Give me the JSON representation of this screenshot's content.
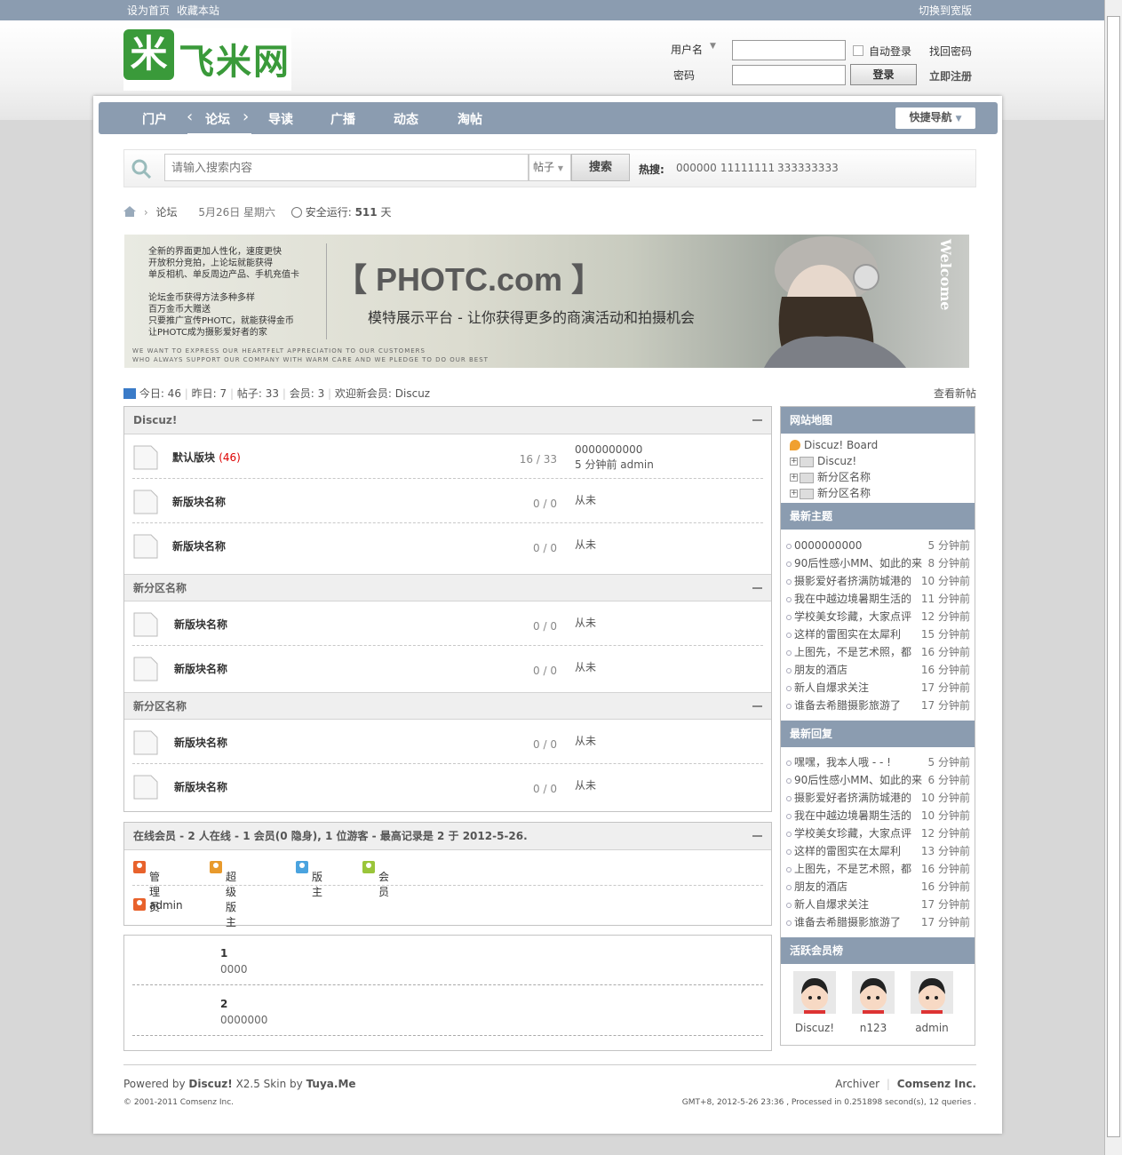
{
  "topbar": {
    "set_home": "设为首页",
    "bookmark": "收藏本站",
    "switch_wide": "切换到宽版"
  },
  "logo": {
    "char": "米",
    "name": "飞米网"
  },
  "login": {
    "username_label": "用户名",
    "password_label": "密码",
    "auto_login": "自动登录",
    "find_password": "找回密码",
    "login_button": "登录",
    "register": "立即注册"
  },
  "nav": {
    "items": [
      "门户",
      "论坛",
      "导读",
      "广播",
      "动态",
      "淘帖"
    ],
    "quick_nav": "快捷导航"
  },
  "search": {
    "placeholder": "请输入搜索内容",
    "type": "帖子",
    "button": "搜索",
    "hot_label": "热搜:",
    "hot_words": [
      "000000",
      "11111111",
      "333333333"
    ]
  },
  "breadcrumb": {
    "forum": "论坛",
    "date": "5月26日 星期六",
    "uptime_label": "安全运行:",
    "uptime_value": "511",
    "uptime_unit": "天"
  },
  "banner": {
    "lines": [
      "全新的界面更加人性化，速度更快",
      "开放积分竞拍，上论坛就能获得",
      "单反相机、单反周边产品、手机充值卡",
      "",
      "论坛金币获得方法多种多样",
      "百万金币大赠送",
      "只要推广宣传PHOTC，就能获得金币",
      "让PHOTC成为摄影爱好者的家"
    ],
    "title": "【 PHOTC.com 】",
    "subtitle": "模特展示平台 - 让你获得更多的商演活动和拍摄机会",
    "eng1": "WE WANT TO EXPRESS OUR HEARTFELT APPRECIATION TO OUR CUSTOMERS",
    "eng2": "WHO ALWAYS SUPPORT OUR COMPANY WITH WARM CARE AND WE PLEDGE TO DO OUR BEST",
    "welcome": "Welcome"
  },
  "stats": {
    "today": "今日: 46",
    "yesterday": "昨日: 7",
    "posts": "帖子: 33",
    "members": "会员: 3",
    "welcome": "欢迎新会员: Discuz",
    "view_new": "查看新帖"
  },
  "categories": [
    {
      "name": "Discuz!",
      "forums": [
        {
          "name": "默认版块",
          "today": "(46)",
          "count": "16 / 33",
          "last1": "0000000000",
          "last2": "5 分钟前  admin"
        },
        {
          "name": "新版块名称",
          "today": "",
          "count": "0 / 0",
          "last1": "从未",
          "last2": ""
        },
        {
          "name": "新版块名称",
          "today": "",
          "count": "0 / 0",
          "last1": "从未",
          "last2": ""
        }
      ]
    },
    {
      "name": "新分区名称",
      "forums": [
        {
          "name": "新版块名称",
          "today": "",
          "count": "0 / 0",
          "last1": "从未",
          "last2": ""
        },
        {
          "name": "新版块名称",
          "today": "",
          "count": "0 / 0",
          "last1": "从未",
          "last2": ""
        }
      ]
    },
    {
      "name": "新分区名称",
      "forums": [
        {
          "name": "新版块名称",
          "today": "",
          "count": "0 / 0",
          "last1": "从未",
          "last2": ""
        },
        {
          "name": "新版块名称",
          "today": "",
          "count": "0 / 0",
          "last1": "从未",
          "last2": ""
        }
      ]
    }
  ],
  "online": {
    "title": "在线会员 - 2 人在线 - 1 会员(0 隐身), 1 位游客 - 最高记录是 2 于 2012-5-26.",
    "legend": [
      "管理员",
      "超级版主",
      "版主",
      "会员"
    ],
    "users": [
      "admin"
    ],
    "colors": [
      "#e8622c",
      "#e89a2c",
      "#4aa3df",
      "#9ac53a"
    ]
  },
  "notices": [
    {
      "num": "1",
      "text": "0000"
    },
    {
      "num": "2",
      "text": "0000000"
    }
  ],
  "sidebar": {
    "sitemap_title": "网站地图",
    "tree": [
      "Discuz! Board",
      "Discuz!",
      "新分区名称",
      "新分区名称"
    ],
    "latest_title": "最新主题",
    "latest": [
      [
        "0000000000",
        "5 分钟前"
      ],
      [
        "90后性感小MM、如此的来",
        "8 分钟前"
      ],
      [
        "摄影爱好者挤满防城港的",
        "10 分钟前"
      ],
      [
        "我在中越边境暑期生活的",
        "11 分钟前"
      ],
      [
        "学校美女珍藏，大家点评",
        "12 分钟前"
      ],
      [
        "这样的雷图实在太犀利",
        "15 分钟前"
      ],
      [
        "上图先，不是艺术照，都",
        "16 分钟前"
      ],
      [
        "朋友的酒店",
        "16 分钟前"
      ],
      [
        "新人自爆求关注",
        "17 分钟前"
      ],
      [
        "谁备去希腊摄影旅游了",
        "17 分钟前"
      ]
    ],
    "reply_title": "最新回复",
    "replies": [
      [
        "嘿嘿，我本人哦 - - !",
        "5 分钟前"
      ],
      [
        "90后性感小MM、如此的来",
        "6 分钟前"
      ],
      [
        "摄影爱好者挤满防城港的",
        "10 分钟前"
      ],
      [
        "我在中越边境暑期生活的",
        "10 分钟前"
      ],
      [
        "学校美女珍藏，大家点评",
        "12 分钟前"
      ],
      [
        "这样的雷图实在太犀利",
        "13 分钟前"
      ],
      [
        "上图先，不是艺术照，都",
        "16 分钟前"
      ],
      [
        "朋友的酒店",
        "16 分钟前"
      ],
      [
        "新人自爆求关注",
        "17 分钟前"
      ],
      [
        "谁备去希腊摄影旅游了",
        "17 分钟前"
      ]
    ],
    "active_title": "活跃会员榜",
    "active": [
      "Discuz!",
      "n123",
      "admin"
    ]
  },
  "footer": {
    "powered": "Powered by",
    "discuz": "Discuz!",
    "version": "X2.5 Skin by",
    "tuya": "Tuya.Me",
    "copyright": "© 2001-2011 Comsenz Inc.",
    "archiver": "Archiver",
    "comsenz": "Comsenz Inc.",
    "processed": "GMT+8, 2012-5-26 23:36 , Processed in 0.251898 second(s), 12 queries ."
  }
}
